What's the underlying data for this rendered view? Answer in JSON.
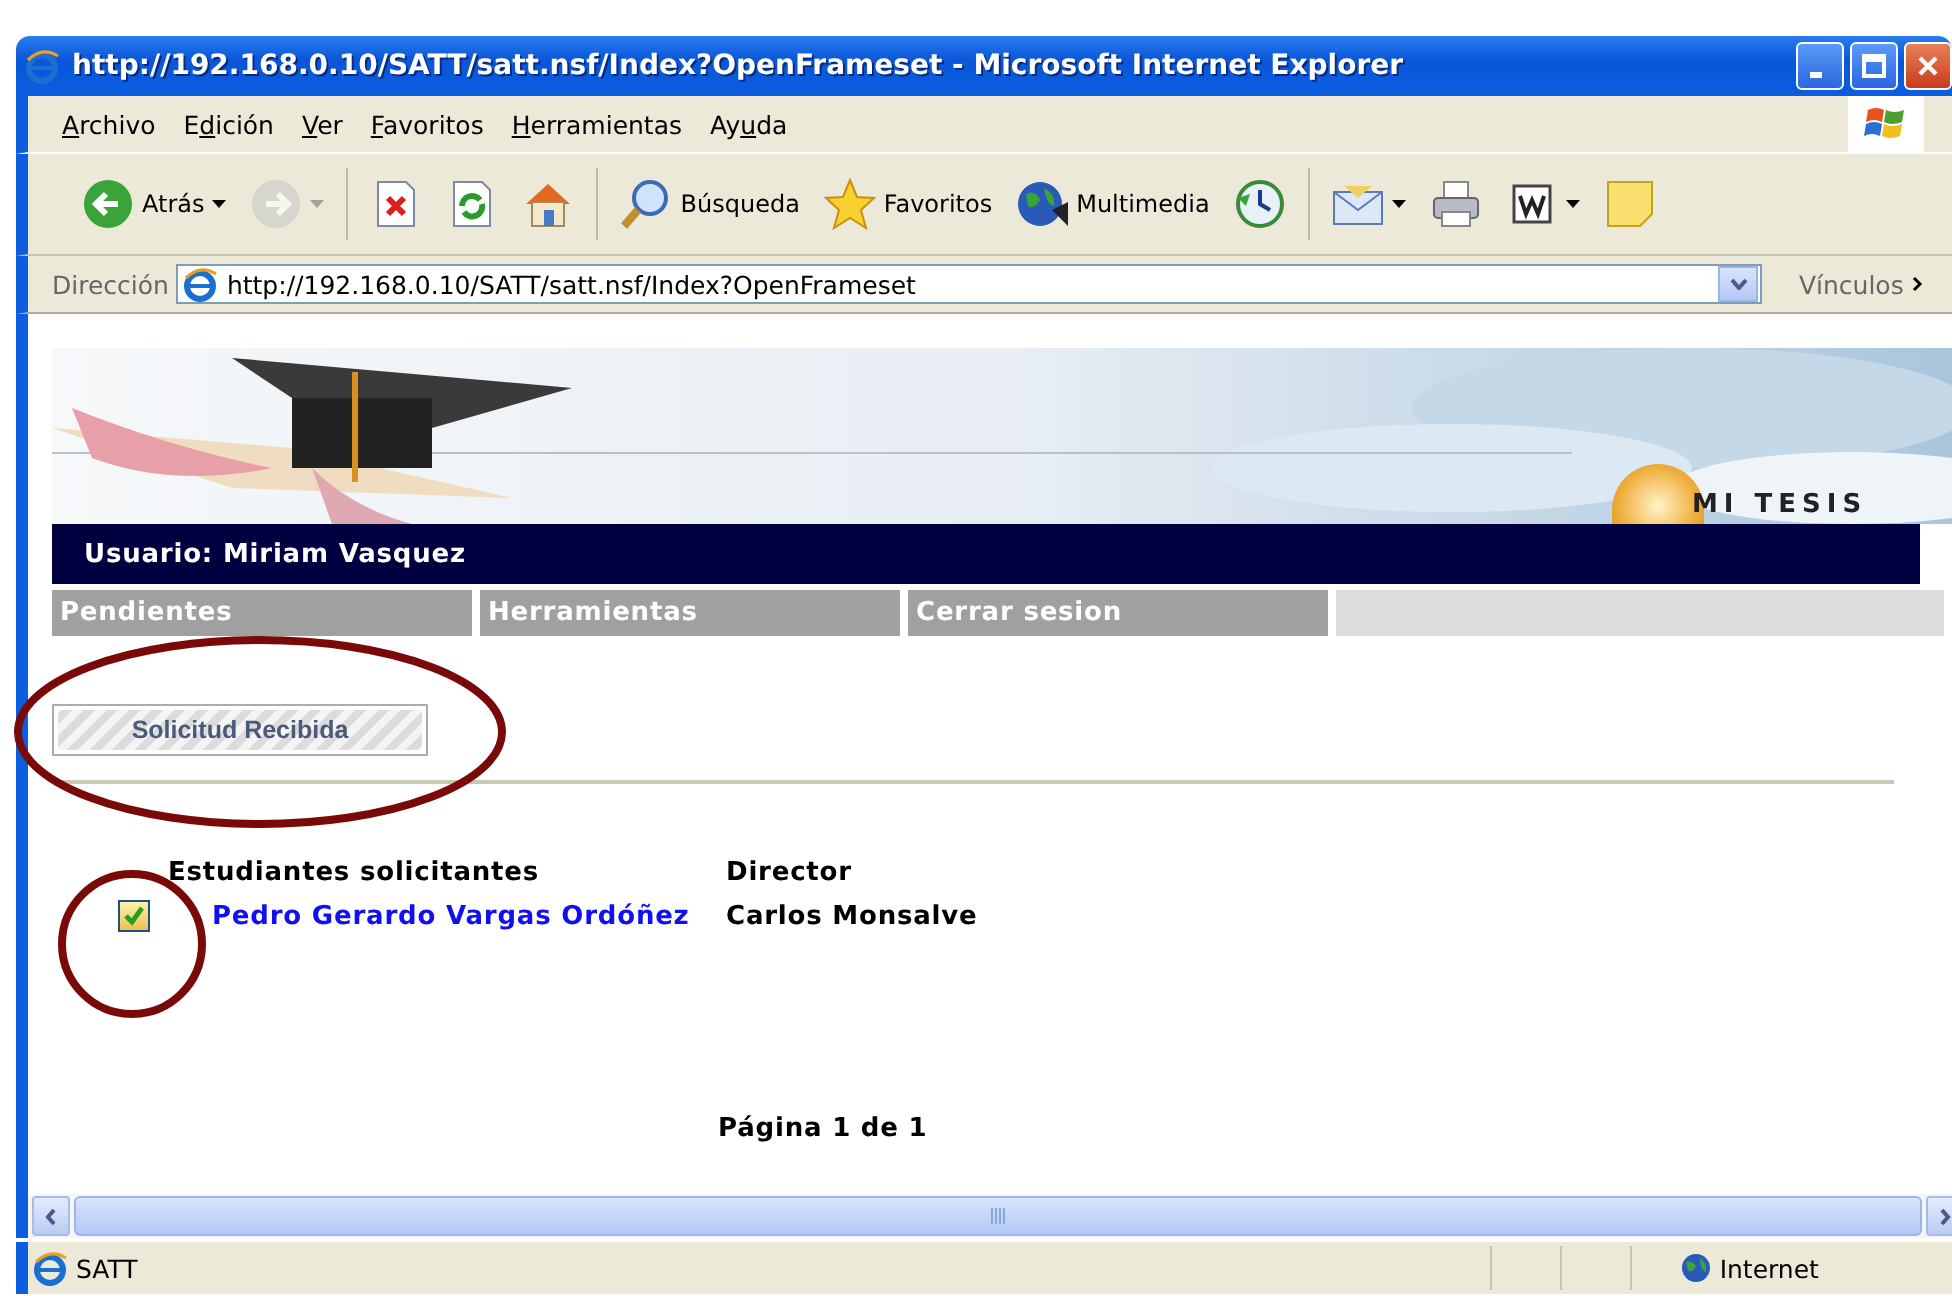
{
  "window": {
    "title": "http://192.168.0.10/SATT/satt.nsf/Index?OpenFrameset - Microsoft Internet Explorer"
  },
  "menu": [
    {
      "label": "Archivo"
    },
    {
      "label": "Edición"
    },
    {
      "label": "Ver"
    },
    {
      "label": "Favoritos"
    },
    {
      "label": "Herramientas"
    },
    {
      "label": "Ayuda"
    }
  ],
  "toolbar": [
    {
      "kind": "back",
      "label": "Atrás",
      "dropdown": true,
      "disabled": false
    },
    {
      "kind": "forward",
      "dropdown": true,
      "disabled": true
    },
    {
      "kind": "stop",
      "dropdown": false,
      "disabled": false
    },
    {
      "kind": "refresh",
      "dropdown": false,
      "disabled": false
    },
    {
      "kind": "home",
      "dropdown": false,
      "disabled": false
    },
    {
      "kind": "search",
      "label": "Búsqueda",
      "dropdown": false,
      "disabled": false
    },
    {
      "kind": "favorites",
      "label": "Favoritos",
      "dropdown": false,
      "disabled": false
    },
    {
      "kind": "media",
      "label": "Multimedia",
      "dropdown": false,
      "disabled": false
    },
    {
      "kind": "history",
      "dropdown": false,
      "disabled": false
    },
    {
      "kind": "mail",
      "dropdown": true,
      "disabled": false
    },
    {
      "kind": "print",
      "dropdown": false,
      "disabled": false
    },
    {
      "kind": "edit",
      "dropdown": true,
      "disabled": false
    },
    {
      "kind": "note",
      "dropdown": false,
      "disabled": false
    }
  ],
  "address_bar": {
    "label": "Dirección",
    "value": "http://192.168.0.10/SATT/satt.nsf/Index?OpenFrameset",
    "links": "Vínculos"
  },
  "page": {
    "user": "Usuario: Miriam Vasquez",
    "logo": "MI TESIS",
    "nav": [
      {
        "label": "Pendientes"
      },
      {
        "label": "Herramientas"
      },
      {
        "label": "Cerrar sesion"
      }
    ],
    "action_button": "Solicitud Recibida",
    "columns": [
      "Estudiantes solicitantes",
      "Director"
    ],
    "rows": [
      {
        "checked": true,
        "student": "Pedro Gerardo Vargas Ordóñez",
        "director": "Carlos Monsalve"
      }
    ],
    "pager": "Página 1 de 1"
  },
  "status_bar": {
    "text": "SATT",
    "zone": "Internet"
  },
  "annotations": [
    {
      "kind": "ellipse"
    },
    {
      "kind": "circle"
    }
  ]
}
